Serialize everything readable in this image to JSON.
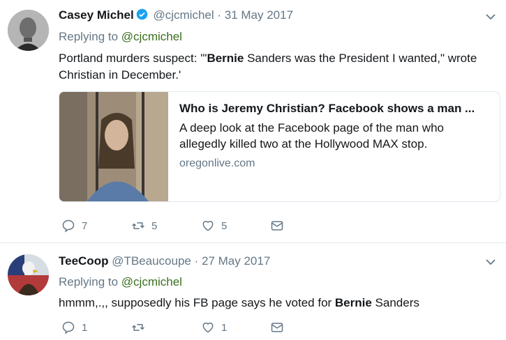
{
  "tweets": [
    {
      "name": "Casey Michel",
      "handle": "@cjcmichel",
      "date": "· 31 May 2017",
      "replying_prefix": "Replying to ",
      "replying_handle": "@cjcmichel",
      "text_before": "Portland murders suspect: '\"",
      "text_bold": "Bernie",
      "text_after": " Sanders was the President I wanted,\" wrote Christian in December.'",
      "card": {
        "title": "Who is Jeremy Christian? Facebook shows a man ...",
        "description": "A deep look at the Facebook page of the man who allegedly killed two at the Hollywood MAX stop.",
        "domain": "oregonlive.com"
      },
      "actions": {
        "replies": "7",
        "retweets": "5",
        "likes": "5"
      }
    },
    {
      "name": "TeeCoop",
      "handle": "@TBeaucoupe",
      "date": "· 27 May 2017",
      "replying_prefix": "Replying to ",
      "replying_handle": "@cjcmichel",
      "text_before": "hmmm,.,, supposedly his FB page says he voted for ",
      "text_bold": "Bernie",
      "text_after": " Sanders",
      "actions": {
        "replies": "1",
        "retweets": "",
        "likes": "1"
      }
    }
  ],
  "colors": {
    "verified": "#1da1f2",
    "icon": "#657786",
    "reply_handle": "#3a6f1e"
  }
}
